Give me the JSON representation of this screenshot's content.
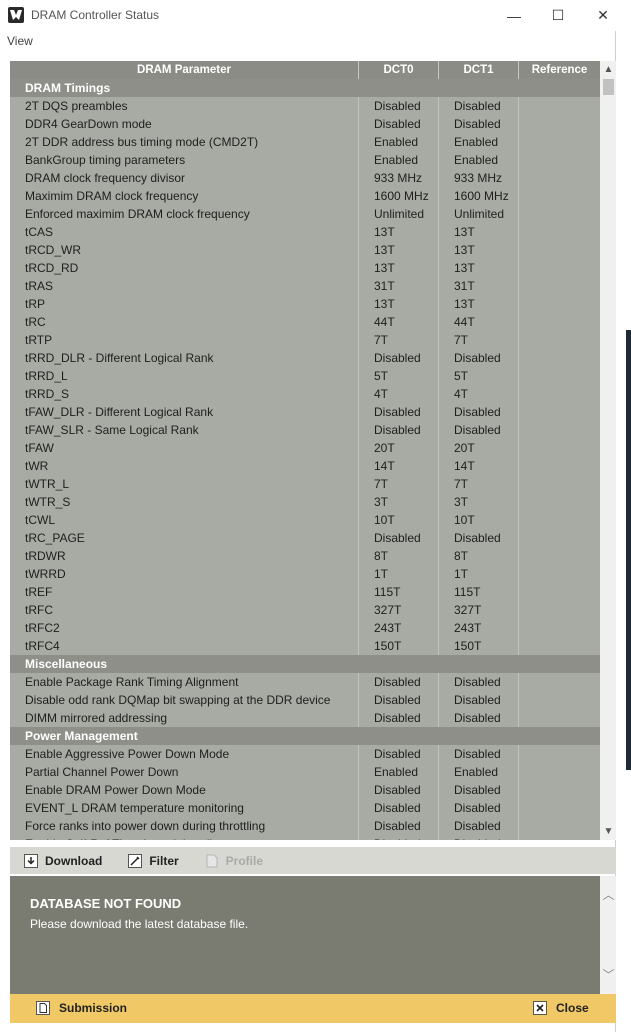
{
  "window": {
    "title": "DRAM Controller Status",
    "minimize_glyph": "—",
    "maximize_glyph": "☐",
    "close_glyph": "✕"
  },
  "menu": {
    "view": "View"
  },
  "table": {
    "headers": {
      "param": "DRAM Parameter",
      "dct0": "DCT0",
      "dct1": "DCT1",
      "ref": "Reference"
    },
    "sections": [
      {
        "title": "DRAM Timings",
        "rows": [
          [
            "2T DQS preambles",
            "Disabled",
            "Disabled",
            ""
          ],
          [
            "DDR4 GearDown mode",
            "Disabled",
            "Disabled",
            ""
          ],
          [
            "2T DDR address bus timing mode (CMD2T)",
            "Enabled",
            "Enabled",
            ""
          ],
          [
            "BankGroup timing parameters",
            "Enabled",
            "Enabled",
            ""
          ],
          [
            "DRAM clock frequency divisor",
            "933 MHz",
            "933 MHz",
            ""
          ],
          [
            "Maximim DRAM clock frequency",
            "1600 MHz",
            "1600 MHz",
            ""
          ],
          [
            "Enforced maximim DRAM clock frequency",
            "Unlimited",
            "Unlimited",
            ""
          ],
          [
            "tCAS",
            "13T",
            "13T",
            ""
          ],
          [
            "tRCD_WR",
            "13T",
            "13T",
            ""
          ],
          [
            "tRCD_RD",
            "13T",
            "13T",
            ""
          ],
          [
            "tRAS",
            "31T",
            "31T",
            ""
          ],
          [
            "tRP",
            "13T",
            "13T",
            ""
          ],
          [
            "tRC",
            "44T",
            "44T",
            ""
          ],
          [
            "tRTP",
            "7T",
            "7T",
            ""
          ],
          [
            "tRRD_DLR - Different Logical Rank",
            "Disabled",
            "Disabled",
            ""
          ],
          [
            "tRRD_L",
            "5T",
            "5T",
            ""
          ],
          [
            "tRRD_S",
            "4T",
            "4T",
            ""
          ],
          [
            "tFAW_DLR - Different Logical Rank",
            "Disabled",
            "Disabled",
            ""
          ],
          [
            "tFAW_SLR - Same Logical Rank",
            "Disabled",
            "Disabled",
            ""
          ],
          [
            "tFAW",
            "20T",
            "20T",
            ""
          ],
          [
            "tWR",
            "14T",
            "14T",
            ""
          ],
          [
            "tWTR_L",
            "7T",
            "7T",
            ""
          ],
          [
            "tWTR_S",
            "3T",
            "3T",
            ""
          ],
          [
            "tCWL",
            "10T",
            "10T",
            ""
          ],
          [
            "tRC_PAGE",
            "Disabled",
            "Disabled",
            ""
          ],
          [
            "tRDWR",
            "8T",
            "8T",
            ""
          ],
          [
            "tWRRD",
            "1T",
            "1T",
            ""
          ],
          [
            "tREF",
            "115T",
            "115T",
            ""
          ],
          [
            "tRFC",
            "327T",
            "327T",
            ""
          ],
          [
            "tRFC2",
            "243T",
            "243T",
            ""
          ],
          [
            "tRFC4",
            "150T",
            "150T",
            ""
          ]
        ]
      },
      {
        "title": "Miscellaneous",
        "rows": [
          [
            "Enable Package Rank Timing Alignment",
            "Disabled",
            "Disabled",
            ""
          ],
          [
            "Disable odd rank DQMap bit swapping at the DDR device",
            "Disabled",
            "Disabled",
            ""
          ],
          [
            "DIMM mirrored addressing",
            "Disabled",
            "Disabled",
            ""
          ]
        ]
      },
      {
        "title": "Power Management",
        "rows": [
          [
            "Enable Aggressive Power Down Mode",
            "Disabled",
            "Disabled",
            ""
          ],
          [
            "Partial Channel Power Down",
            "Enabled",
            "Enabled",
            ""
          ],
          [
            "Enable DRAM Power Down Mode",
            "Disabled",
            "Disabled",
            ""
          ],
          [
            "EVENT_L DRAM temperature monitoring",
            "Disabled",
            "Disabled",
            ""
          ],
          [
            "Force ranks into power down during throttling",
            "Disabled",
            "Disabled",
            ""
          ],
          [
            "Enable Self-Ref Throttle and throttling",
            "Disabled",
            "Disabled",
            ""
          ]
        ]
      }
    ]
  },
  "toolbar": {
    "download": "Download",
    "filter": "Filter",
    "profile": "Profile"
  },
  "message": {
    "title": "DATABASE NOT FOUND",
    "text": "Please download the latest database file."
  },
  "bottom": {
    "submission": "Submission",
    "close": "Close"
  },
  "colors": {
    "table_bg": "#a8aba3",
    "section_bg": "#8d8f88",
    "message_bg": "#7a7c72",
    "bottom_bar": "#f0c866"
  }
}
